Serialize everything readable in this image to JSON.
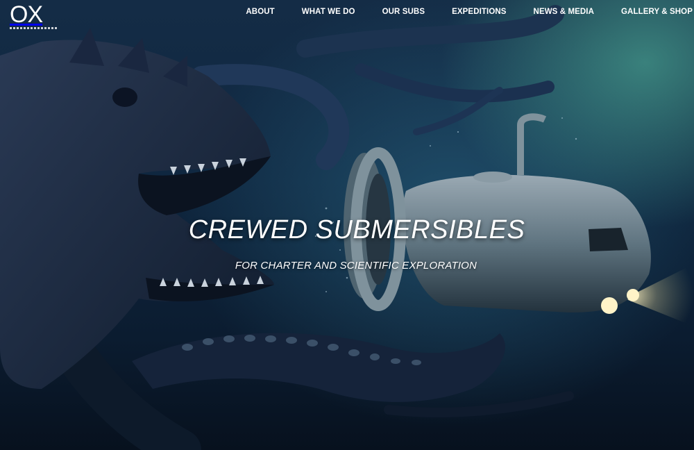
{
  "logo": {
    "text": "OX"
  },
  "nav": {
    "items": [
      {
        "label": "ABOUT"
      },
      {
        "label": "WHAT WE DO"
      },
      {
        "label": "OUR SUBS"
      },
      {
        "label": "EXPEDITIONS"
      },
      {
        "label": "NEWS & MEDIA"
      },
      {
        "label": "GALLERY & SHOP"
      }
    ]
  },
  "hero": {
    "title": "CREWED SUBMERSIBLES",
    "subtitle": "FOR CHARTER AND SCIENTIFIC EXPLORATION"
  },
  "colors": {
    "water_dark": "#0a1a2c",
    "water_glow": "#5ac8aa",
    "text": "#ffffff"
  }
}
